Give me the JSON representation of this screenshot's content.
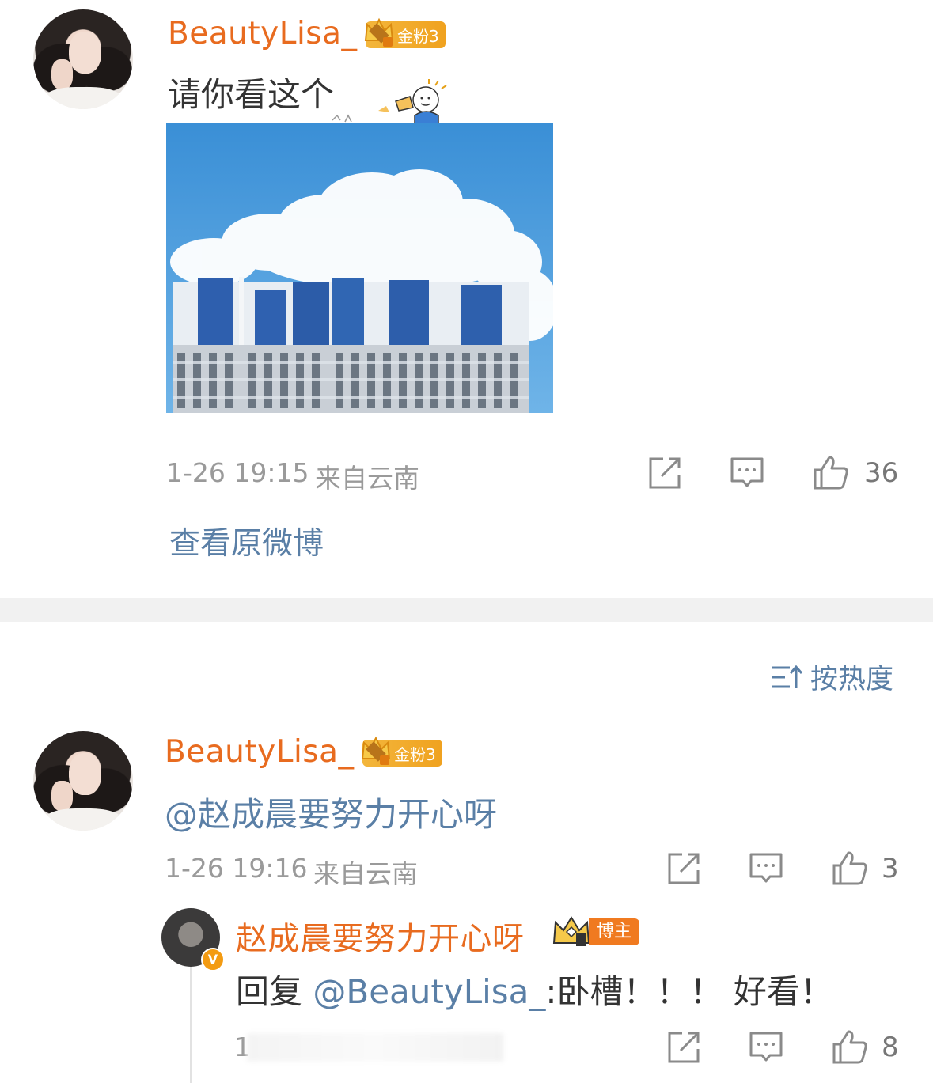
{
  "post": {
    "username": "BeautyLisa_",
    "fan_badge": "金粉3",
    "text": "请你看这个",
    "time": "1-26 19:15",
    "location": "来自云南",
    "likes": "36",
    "view_original": "查看原微博"
  },
  "sort": {
    "label": "按热度"
  },
  "comment": {
    "username": "BeautyLisa_",
    "fan_badge": "金粉3",
    "mention": "@赵成晨要努力开心呀",
    "time": "1-26 19:16",
    "location": "来自云南",
    "likes": "3"
  },
  "reply": {
    "username": "赵成晨要努力开心呀",
    "role_badge": "博主",
    "prefix": "回复",
    "mention": "@BeautyLisa_",
    "text": ":卧槽！！！ 好看！",
    "time_partial": "1",
    "likes": "8"
  },
  "colors": {
    "username": "#e86b1f",
    "link": "#5a7fa6",
    "meta": "#9a9a9a",
    "badge": "#f0a21f",
    "sky": "#3d97db"
  }
}
